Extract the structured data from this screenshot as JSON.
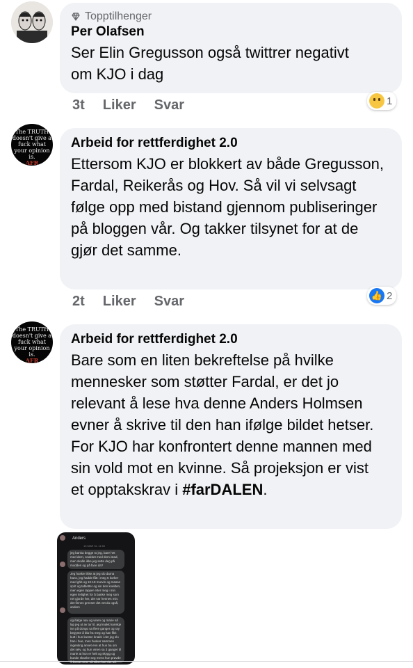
{
  "comments": [
    {
      "badge": "Topptilhenger",
      "author": "Per Olafsen",
      "text": "Ser Elin Gregusson også twittrer negativt om KJO i dag",
      "time": "3t",
      "like_label": "Liker",
      "reply_label": "Svar",
      "reaction": "sad",
      "reaction_count": "1"
    },
    {
      "author": "Arbeid for rettferdighet  2.0",
      "text": "Ettersom KJO er blokkert av både Gregusson, Fardal, Reikerås og Hov. Så vil vi selvsagt følge opp med bistand gjennom publiseringer på bloggen vår. Og takker tilsynet for at de gjør det samme.",
      "time": "2t",
      "like_label": "Liker",
      "reply_label": "Svar",
      "reaction": "like",
      "reaction_count": "2",
      "avatar_motto": "The TRUTH doesn't give a fuck what your opinion is.",
      "avatar_tag": "AFR"
    },
    {
      "author": "Arbeid for rettferdighet  2.0",
      "text": "Bare som en liten bekreftelse på hvilke mennesker som støtter Fardal, er det jo relevant å lese hva denne Anders Holmsen evner å skrive til den han ifølge bildet hetser. For KJO har konfrontert denne mannen med sin vold mot en kvinne. Så projeksjon er vist et opptakskrav i",
      "hashtag": "#farDALEN",
      "trailing": ".",
      "avatar_motto": "The TRUTH doesn't give a fuck what your opinion is.",
      "avatar_tag": "AFR"
    }
  ],
  "attachment": {
    "name": "Anders",
    "time": "13 MAR KL 11:50",
    "messages": [
      "jeg banka begge to jeg, bare het med dem, snakket med dem istad, men skulle ikke jeg sette deg på modden og på face da?",
      "Jeg husker ikke at jeg slo darna hans, jeg hadde fått i meg 5 korker med ghb og 10-18 murvin og masse sprit og tabletter og sin den kvelden, men egen tapper etter meg i min egen leilighet for å banke meg som nei gjorde her, det var hennes min. det finnes grenser det vet du også, anders",
      "og ifølge nav og vinen og marie så lap jeg ut av tur til, jeg knakk kanskje inn på dongo sa flere ganger og ray begynte å bla fra meg og han fikk kutt i hun kusten knakk i det jeg slo han i hue, men husker sammen ingenting annet enn at hun ba om det selv, og hun vinen sa 3 ganger til marie at hun er helt og skygg og bunde skanke seg mens hun prøvde å kysse meg, så sånn kan det gå, men vise ikke fornektet det"
    ]
  },
  "colors": {
    "bubble_bg": "#f0f2f5",
    "meta_text": "#65676b",
    "like_blue": "#1877f2",
    "sad_yellow": "#f7c744"
  }
}
